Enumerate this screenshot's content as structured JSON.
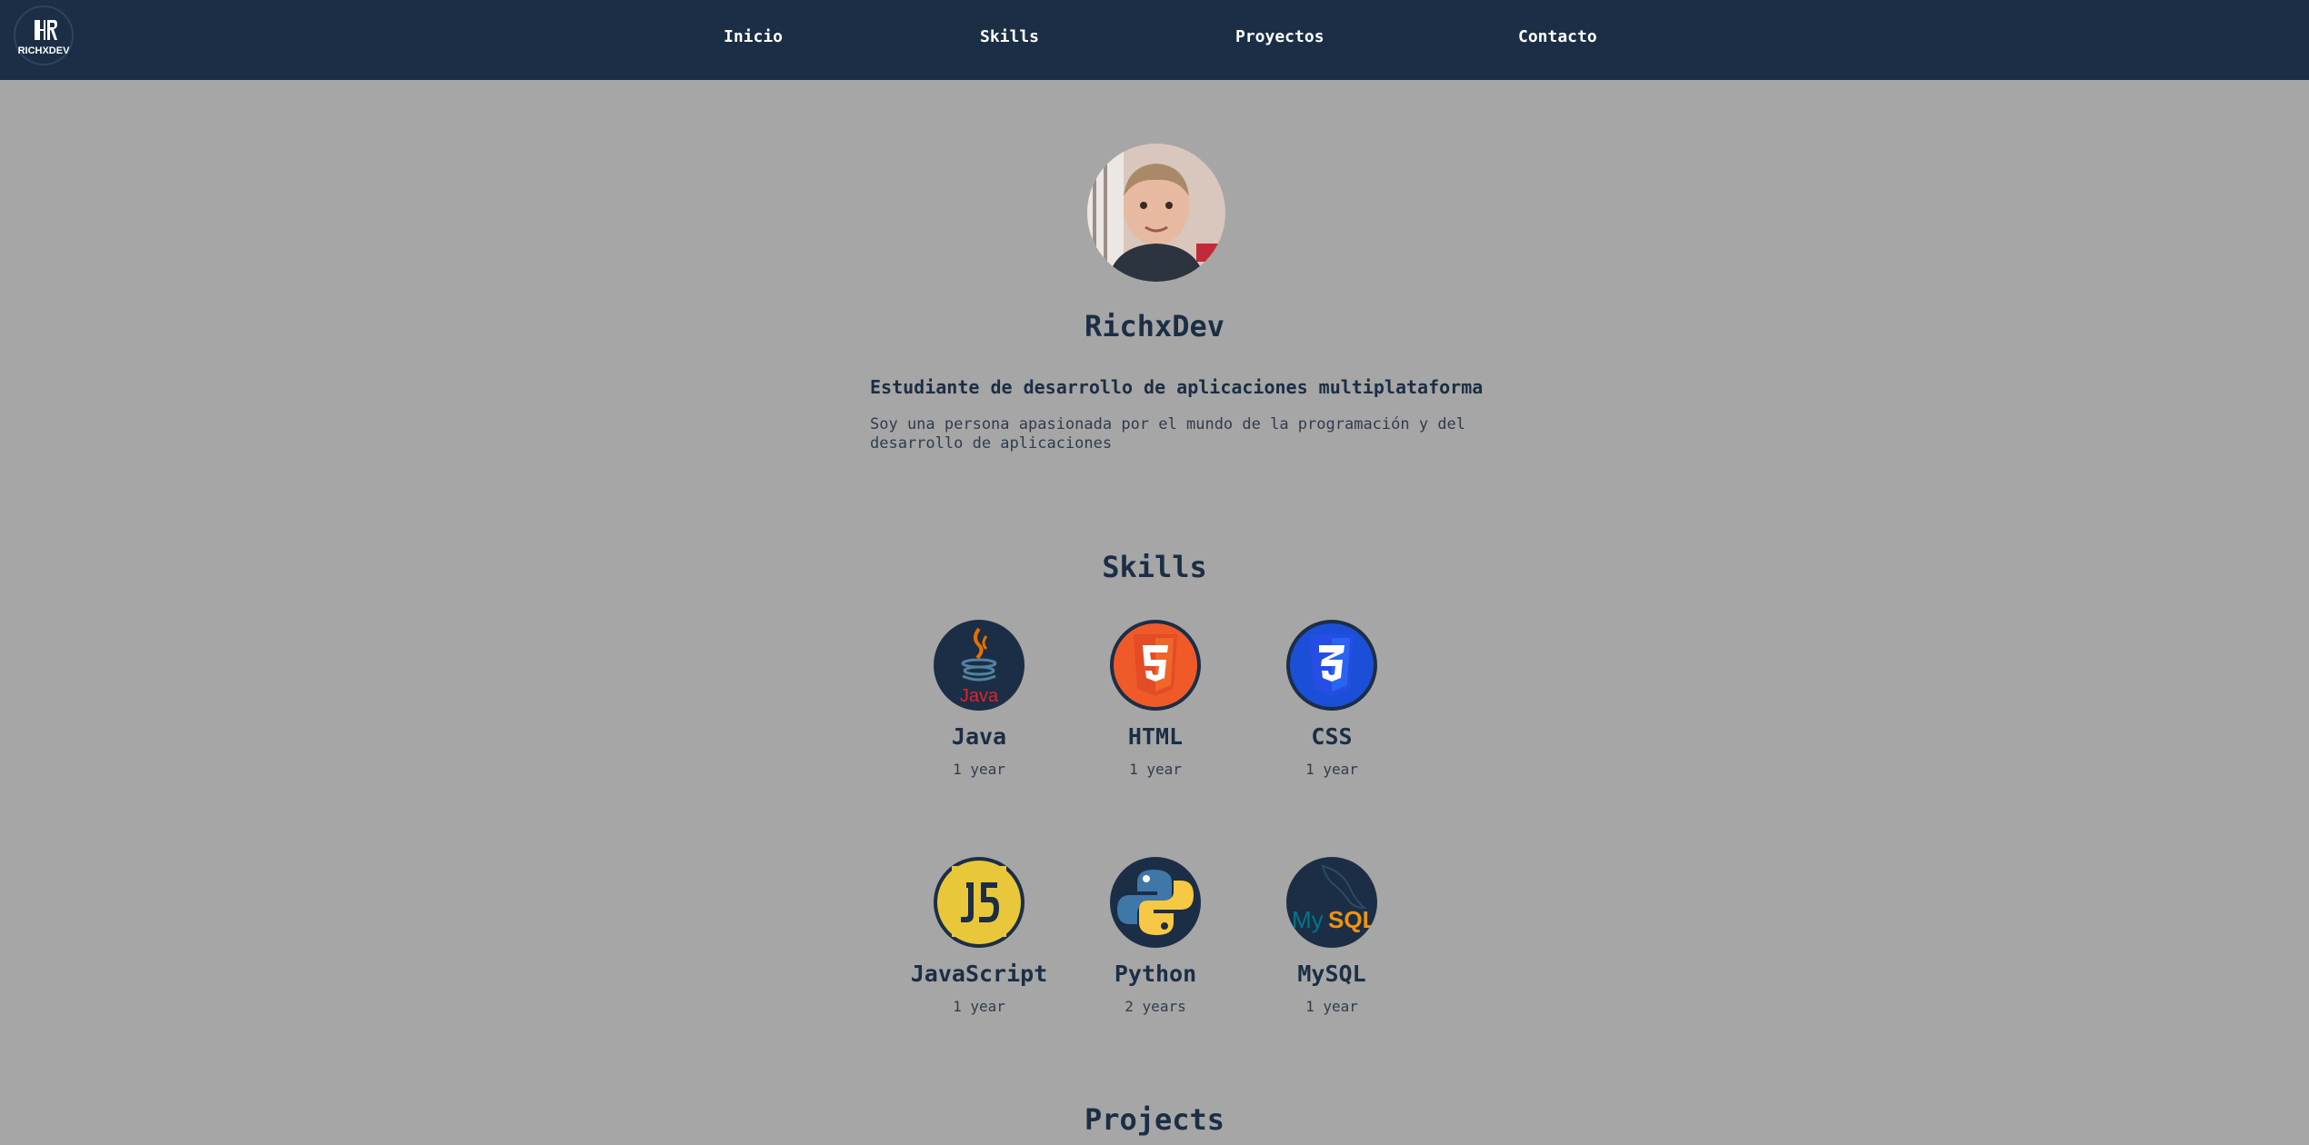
{
  "brand": {
    "logo_text": "RICHXDEV"
  },
  "nav": [
    {
      "label": "Inicio"
    },
    {
      "label": "Skills"
    },
    {
      "label": "Proyectos"
    },
    {
      "label": "Contacto"
    }
  ],
  "profile": {
    "name": "RichxDev",
    "subtitle": "Estudiante de desarrollo de aplicaciones multiplataforma",
    "description": "Soy una persona apasionada por el mundo de la programación y del desarrollo de aplicaciones"
  },
  "skills_section": {
    "title": "Skills",
    "items": [
      {
        "name": "Java",
        "years": "1 year",
        "icon": "java-icon"
      },
      {
        "name": "HTML",
        "years": "1 year",
        "icon": "html5-icon"
      },
      {
        "name": "CSS",
        "years": "1 year",
        "icon": "css3-icon"
      },
      {
        "name": "JavaScript",
        "years": "1 year",
        "icon": "javascript-icon"
      },
      {
        "name": "Python",
        "years": "2 years",
        "icon": "python-icon"
      },
      {
        "name": "MySQL",
        "years": "1 year",
        "icon": "mysql-icon"
      }
    ]
  },
  "projects_section": {
    "title": "Projects"
  },
  "colors": {
    "navbar": "#1b2e45",
    "background": "#a6a6a6",
    "text": "#1b2e45"
  }
}
